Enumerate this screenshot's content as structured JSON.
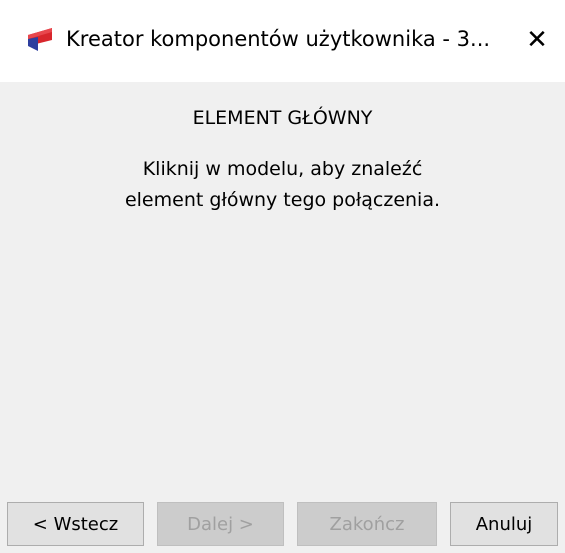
{
  "window": {
    "title": "Kreator komponentów użytkownika - 3...",
    "app_icon": "app-logo-icon",
    "close_icon": "close-icon",
    "close_symbol": "✕"
  },
  "content": {
    "heading": "ELEMENT GŁÓWNY",
    "message_line1": "Kliknij w modelu, aby znaleźć",
    "message_line2": "element główny tego połączenia."
  },
  "buttons": {
    "back": {
      "label": "< Wstecz",
      "enabled": true
    },
    "next": {
      "label": "Dalej >",
      "enabled": false
    },
    "finish": {
      "label": "Zakończ",
      "enabled": false
    },
    "cancel": {
      "label": "Anuluj",
      "enabled": true
    }
  },
  "colors": {
    "icon_red": "#d8262c",
    "icon_blue": "#2d3e9e",
    "window_bg": "#f0f0f0",
    "titlebar_bg": "#ffffff"
  }
}
